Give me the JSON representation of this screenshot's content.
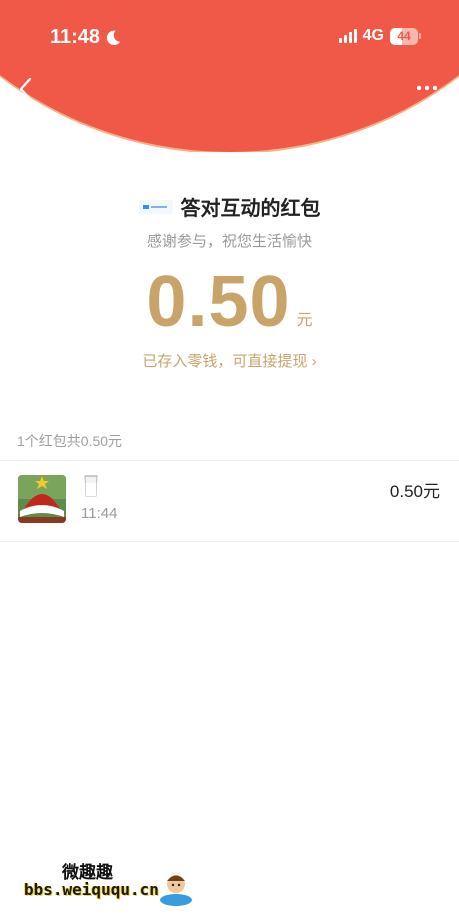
{
  "status_bar": {
    "time": "11:48",
    "network": "4G",
    "battery": "44"
  },
  "packet": {
    "title": "答对互动的红包",
    "subtitle": "感谢参与，祝您生活愉快",
    "amount": "0.50",
    "unit": "元",
    "deposit_note": "已存入零钱，可直接提现 ›"
  },
  "summary": {
    "count_text": "1个红包共0.50元"
  },
  "records": [
    {
      "time": "11:44",
      "amount": "0.50元",
      "emoji": "milk-glass-icon"
    }
  ],
  "watermark": {
    "line1": "微趣趣",
    "line2": "bbs.weiququ.cn"
  },
  "colors": {
    "header_red": "#f05848",
    "gold": "#c9a46a"
  }
}
